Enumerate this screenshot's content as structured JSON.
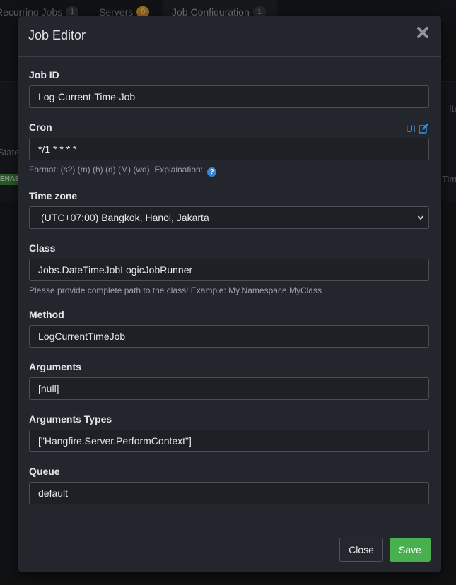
{
  "background": {
    "tabs": [
      {
        "label": "Recurring Jobs",
        "count": "1"
      },
      {
        "label": "Servers",
        "count": "0"
      },
      {
        "label": "Job Configuration",
        "count": "1"
      }
    ],
    "fragments": {
      "state": "State",
      "enabled_chip": "ENABLED",
      "right_top": "Ite",
      "right_mid": "Tim"
    }
  },
  "modal": {
    "title": "Job Editor",
    "fields": {
      "job_id": {
        "label": "Job ID",
        "value": "Log-Current-Time-Job"
      },
      "cron": {
        "label": "Cron",
        "value": "*/1 * * * *",
        "ui_link": "UI",
        "help": "Format: (s?) (m) (h) (d) (M) (wd). Explaination:"
      },
      "time_zone": {
        "label": "Time zone",
        "value": "(UTC+07:00) Bangkok, Hanoi, Jakarta"
      },
      "class": {
        "label": "Class",
        "value": "Jobs.DateTimeJobLogicJobRunner",
        "help": "Please provide complete path to the class! Example: My.Namespace.MyClass"
      },
      "method": {
        "label": "Method",
        "value": "LogCurrentTimeJob"
      },
      "arguments": {
        "label": "Arguments",
        "value": "[null]"
      },
      "arguments_types": {
        "label": "Arguments Types",
        "value": "[\"Hangfire.Server.PerformContext\"]"
      },
      "queue": {
        "label": "Queue",
        "value": "default"
      }
    },
    "buttons": {
      "close": "Close",
      "save": "Save"
    }
  },
  "colors": {
    "accent": "#3a8fde",
    "save": "#49b04f",
    "warn_badge": "#e8a12a"
  },
  "icons": [
    "close-icon",
    "edit-square-icon",
    "question-circle-icon",
    "chevron-down-icon"
  ]
}
